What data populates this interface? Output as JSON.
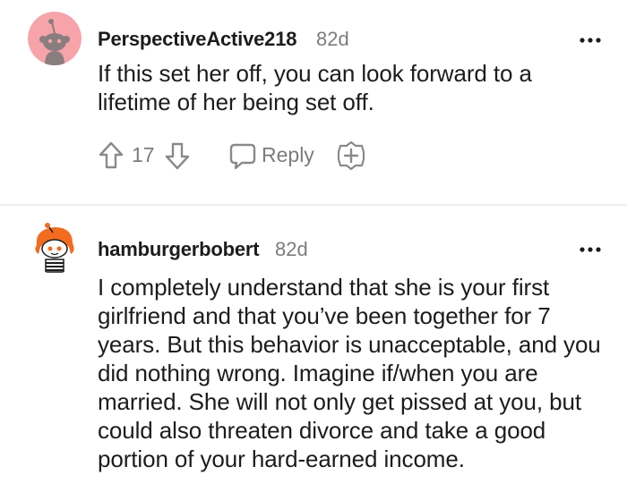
{
  "comments": [
    {
      "username": "PerspectiveActive218",
      "timestamp": "82d",
      "body": "If this set her off, you can look forward to a lifetime of her being set off.",
      "votes": "17",
      "reply_label": "Reply",
      "avatar_icon": "snoo-avatar-icon",
      "avatar_color": "#f7a3aa"
    },
    {
      "username": "hamburgerbobert",
      "timestamp": "82d",
      "body": "I completely understand that she is your first girlfriend and that you’ve been together for 7 years. But this behavior is unacceptable, and you did nothing wrong. Imagine if/when you are married. She will not only get pissed at you, but could also threaten divorce and take a good portion of your hard-earned income.",
      "avatar_icon": "snoo-avatar-icon"
    }
  ],
  "colors": {
    "text": "#1c1c1c",
    "meta": "#7c7c7c",
    "icon": "#878a8c",
    "divider": "#ededed"
  }
}
